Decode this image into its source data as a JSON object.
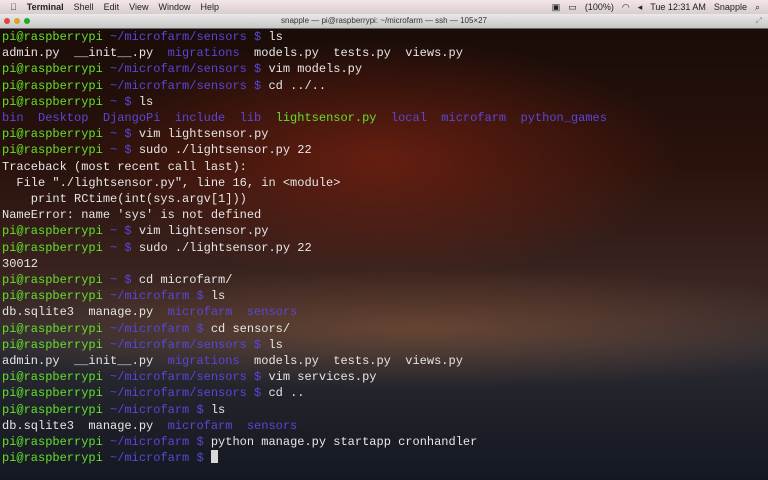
{
  "menubar": {
    "app": "Terminal",
    "items": [
      "Shell",
      "Edit",
      "View",
      "Window",
      "Help"
    ],
    "battery": "(100%)",
    "clock": "Tue 12:31 AM",
    "user": "Snapple"
  },
  "window": {
    "title": "snapple — pi@raspberrypi: ~/microfarm — ssh — 105×27"
  },
  "colors": {
    "prompt": "#63e02a",
    "path": "#5a46d6",
    "text": "#e6e6e6"
  },
  "lines": [
    [
      [
        "g",
        "pi@raspberrypi "
      ],
      [
        "p",
        "~/microfarm/sensors $ "
      ],
      [
        "w",
        "ls"
      ]
    ],
    [
      [
        "w",
        "admin.py  __init__.py  "
      ],
      [
        "p",
        "migrations"
      ],
      [
        "w",
        "  models.py  tests.py  views.py"
      ]
    ],
    [
      [
        "g",
        "pi@raspberrypi "
      ],
      [
        "p",
        "~/microfarm/sensors $ "
      ],
      [
        "w",
        "vim models.py"
      ]
    ],
    [
      [
        "g",
        "pi@raspberrypi "
      ],
      [
        "p",
        "~/microfarm/sensors $ "
      ],
      [
        "w",
        "cd ../.."
      ]
    ],
    [
      [
        "g",
        "pi@raspberrypi "
      ],
      [
        "p",
        "~ $ "
      ],
      [
        "w",
        "ls"
      ]
    ],
    [
      [
        "p",
        "bin  Desktop  DjangoPi  include  lib  "
      ],
      [
        "g",
        "lightsensor.py"
      ],
      [
        "p",
        "  local  microfarm  python_games"
      ]
    ],
    [
      [
        "g",
        "pi@raspberrypi "
      ],
      [
        "p",
        "~ $ "
      ],
      [
        "w",
        "vim lightsensor.py"
      ]
    ],
    [
      [
        "g",
        "pi@raspberrypi "
      ],
      [
        "p",
        "~ $ "
      ],
      [
        "w",
        "sudo ./lightsensor.py 22"
      ]
    ],
    [
      [
        "w",
        "Traceback (most recent call last):"
      ]
    ],
    [
      [
        "w",
        "  File \"./lightsensor.py\", line 16, in <module>"
      ]
    ],
    [
      [
        "w",
        "    print RCtime(int(sys.argv[1]))"
      ]
    ],
    [
      [
        "w",
        "NameError: name 'sys' is not defined"
      ]
    ],
    [
      [
        "g",
        "pi@raspberrypi "
      ],
      [
        "p",
        "~ $ "
      ],
      [
        "w",
        "vim lightsensor.py"
      ]
    ],
    [
      [
        "g",
        "pi@raspberrypi "
      ],
      [
        "p",
        "~ $ "
      ],
      [
        "w",
        "sudo ./lightsensor.py 22"
      ]
    ],
    [
      [
        "w",
        "30012"
      ]
    ],
    [
      [
        "g",
        "pi@raspberrypi "
      ],
      [
        "p",
        "~ $ "
      ],
      [
        "w",
        "cd microfarm/"
      ]
    ],
    [
      [
        "g",
        "pi@raspberrypi "
      ],
      [
        "p",
        "~/microfarm $ "
      ],
      [
        "w",
        "ls"
      ]
    ],
    [
      [
        "w",
        "db.sqlite3  manage.py  "
      ],
      [
        "p",
        "microfarm  sensors"
      ]
    ],
    [
      [
        "g",
        "pi@raspberrypi "
      ],
      [
        "p",
        "~/microfarm $ "
      ],
      [
        "w",
        "cd sensors/"
      ]
    ],
    [
      [
        "g",
        "pi@raspberrypi "
      ],
      [
        "p",
        "~/microfarm/sensors $ "
      ],
      [
        "w",
        "ls"
      ]
    ],
    [
      [
        "w",
        "admin.py  __init__.py  "
      ],
      [
        "p",
        "migrations"
      ],
      [
        "w",
        "  models.py  tests.py  views.py"
      ]
    ],
    [
      [
        "g",
        "pi@raspberrypi "
      ],
      [
        "p",
        "~/microfarm/sensors $ "
      ],
      [
        "w",
        "vim services.py"
      ]
    ],
    [
      [
        "g",
        "pi@raspberrypi "
      ],
      [
        "p",
        "~/microfarm/sensors $ "
      ],
      [
        "w",
        "cd .."
      ]
    ],
    [
      [
        "g",
        "pi@raspberrypi "
      ],
      [
        "p",
        "~/microfarm $ "
      ],
      [
        "w",
        "ls"
      ]
    ],
    [
      [
        "w",
        "db.sqlite3  manage.py  "
      ],
      [
        "p",
        "microfarm  sensors"
      ]
    ],
    [
      [
        "g",
        "pi@raspberrypi "
      ],
      [
        "p",
        "~/microfarm $ "
      ],
      [
        "w",
        "python manage.py startapp cronhandler"
      ]
    ],
    [
      [
        "g",
        "pi@raspberrypi "
      ],
      [
        "p",
        "~/microfarm $ "
      ]
    ]
  ]
}
